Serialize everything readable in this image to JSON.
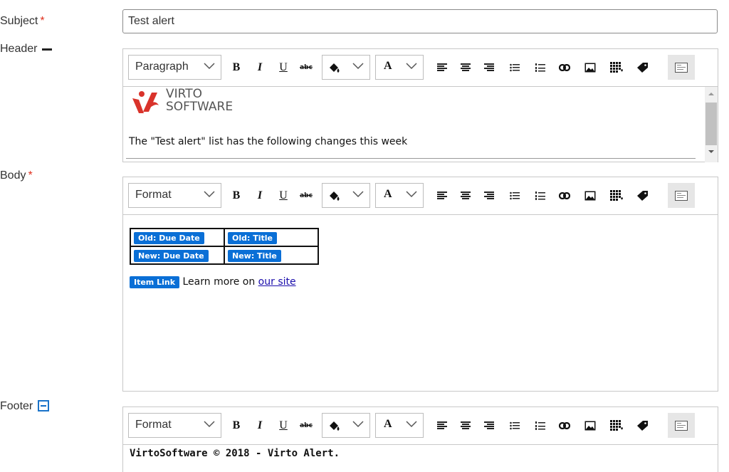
{
  "subject": {
    "label": "Subject",
    "required_mark": "*",
    "value": "Test alert"
  },
  "header": {
    "label": "Header",
    "toolbar": {
      "block_format": "Paragraph",
      "bold": "B",
      "italic": "I",
      "underline": "U",
      "strike": "abc",
      "font_color": "A"
    },
    "logo": {
      "line1": "VIRTO",
      "line2": "SOFTWARE"
    },
    "text": "The \"Test alert\" list has the following changes this week"
  },
  "body": {
    "label": "Body",
    "required_mark": "*",
    "toolbar": {
      "block_format": "Format",
      "bold": "B",
      "italic": "I",
      "underline": "U",
      "strike": "abc",
      "font_color": "A"
    },
    "table": [
      [
        "Old: Due Date",
        "Old: Title"
      ],
      [
        "New: Due Date",
        "New: Title"
      ]
    ],
    "item_link_chip": "Item Link",
    "learn_more": "Learn more on",
    "site_link": "our site"
  },
  "footer": {
    "label": "Footer",
    "toolbar": {
      "block_format": "Format",
      "bold": "B",
      "italic": "I",
      "underline": "U",
      "strike": "abc",
      "font_color": "A"
    },
    "text": "VirtoSoftware © 2018 - Virto Alert."
  },
  "colors": {
    "accent_chip": "#0a6fd6",
    "required": "#e0301e",
    "logo_red": "#d9332b",
    "collapse_icon": "#1a73c9"
  },
  "icons": [
    "highlight-icon",
    "align-left-icon",
    "align-center-icon",
    "align-right-icon",
    "bullet-list-icon",
    "numbered-list-icon",
    "link-icon",
    "image-icon",
    "table-icon",
    "tag-icon",
    "placeholder-icon",
    "minus-icon",
    "collapse-icon"
  ]
}
